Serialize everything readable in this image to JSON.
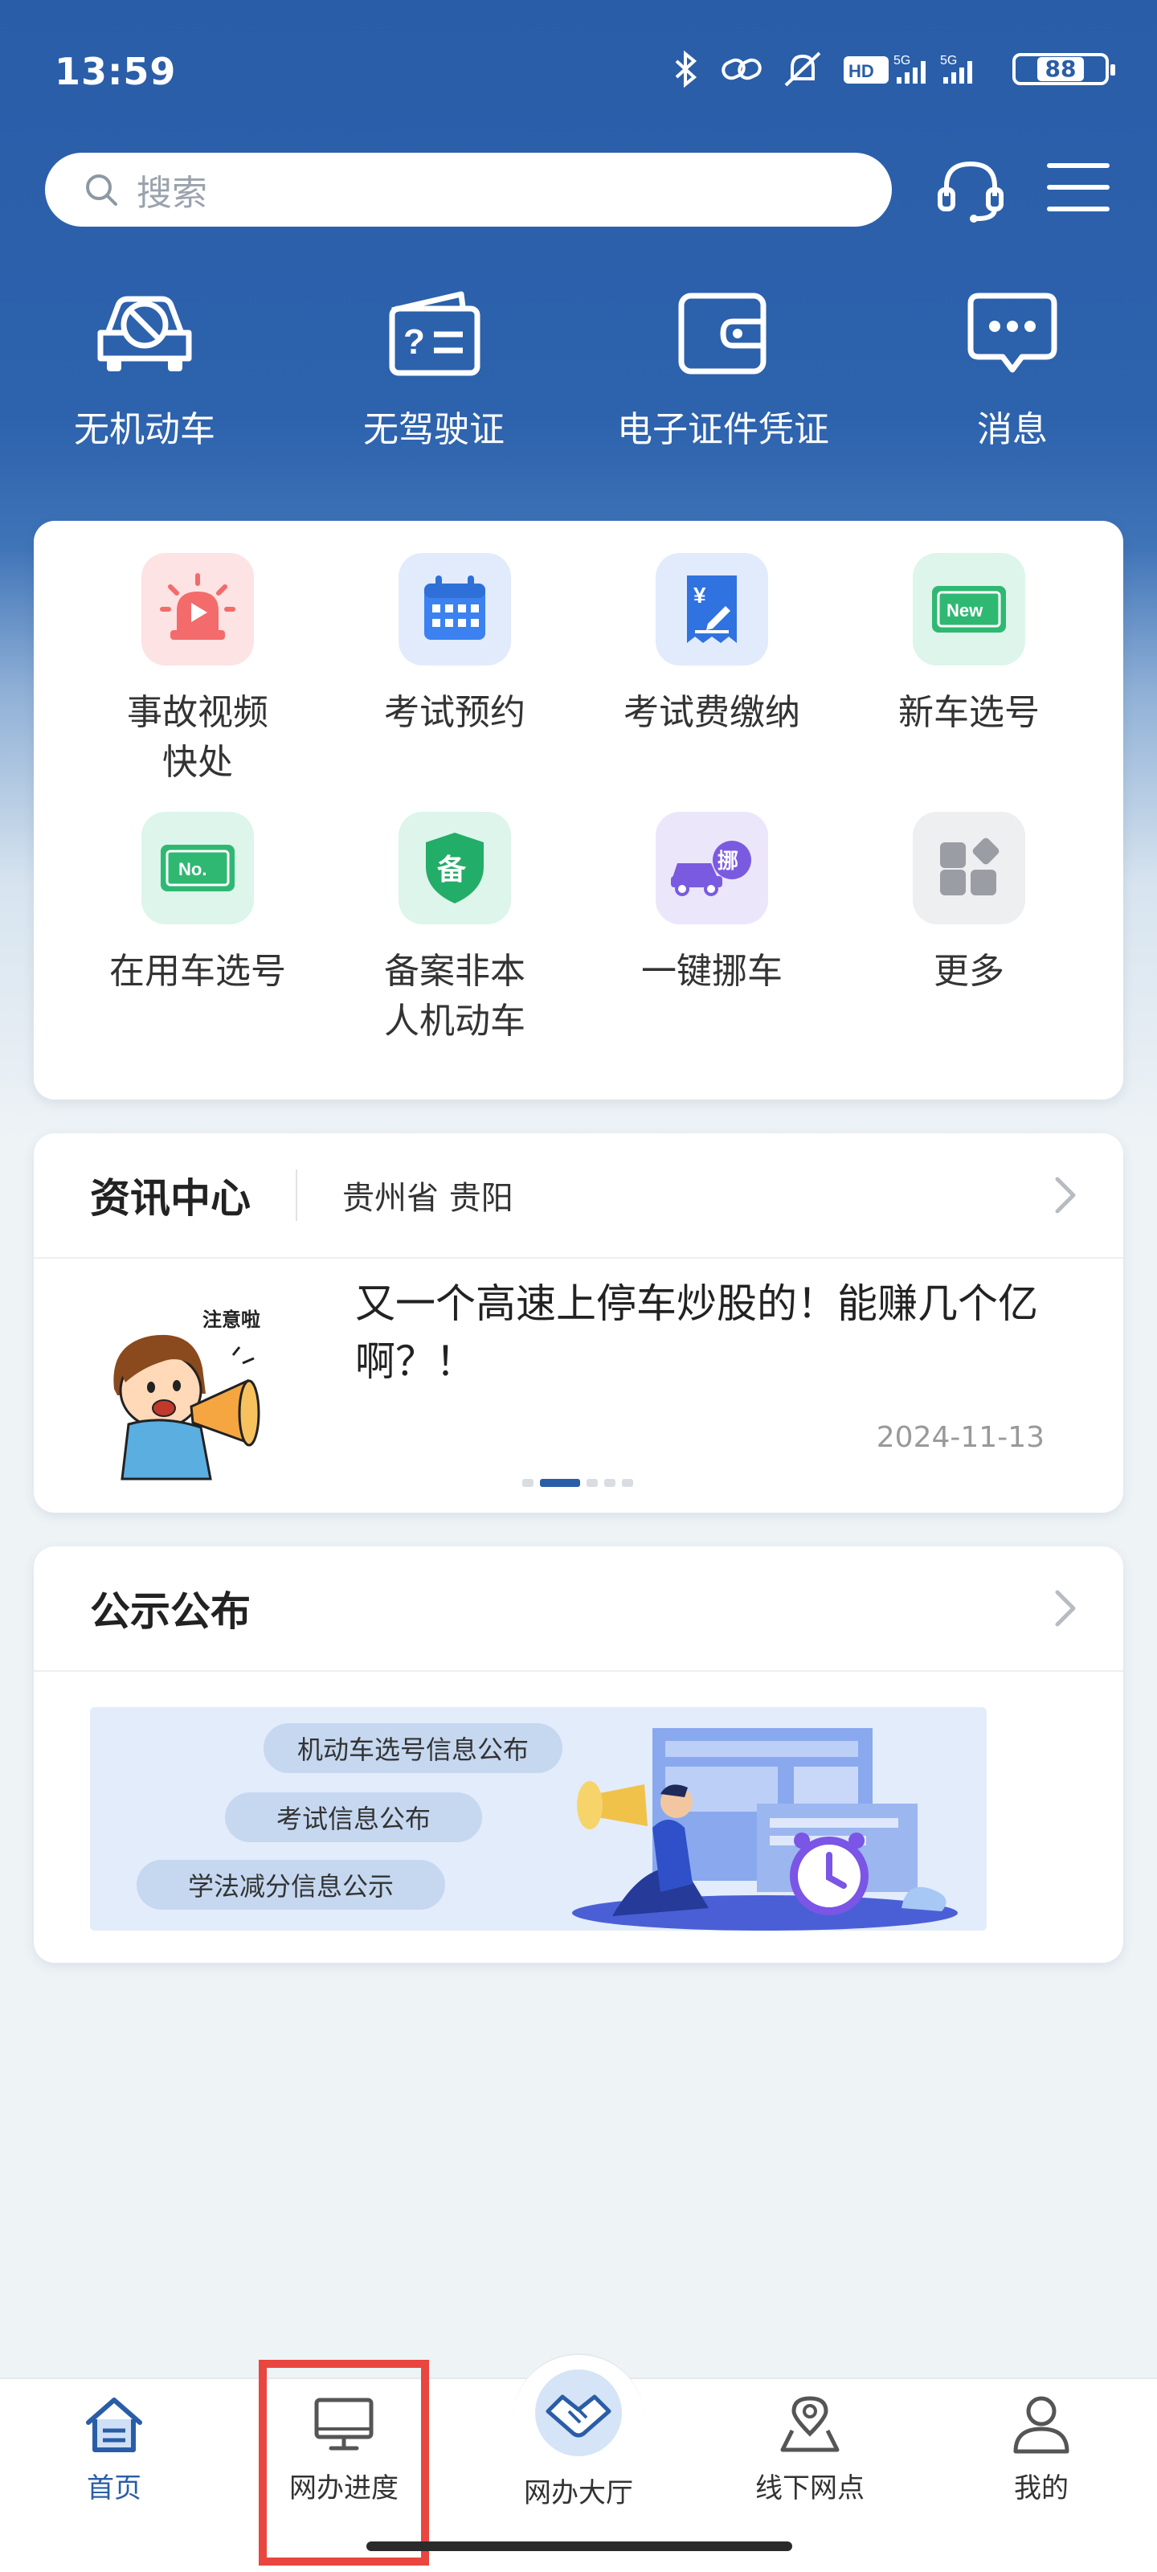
{
  "status_bar": {
    "time": "13:59",
    "battery": "88"
  },
  "search": {
    "placeholder": "搜索"
  },
  "quick_actions": [
    {
      "label": "无机动车",
      "icon": "no-car-icon"
    },
    {
      "label": "无驾驶证",
      "icon": "no-license-icon"
    },
    {
      "label": "电子证件凭证",
      "icon": "wallet-icon"
    },
    {
      "label": "消息",
      "icon": "message-icon"
    }
  ],
  "services": [
    {
      "label": "事故视频\n快处",
      "icon": "alarm-light-icon"
    },
    {
      "label": "考试预约",
      "icon": "calendar-icon"
    },
    {
      "label": "考试费缴纳",
      "icon": "receipt-icon"
    },
    {
      "label": "新车选号",
      "icon": "new-plate-icon"
    },
    {
      "label": "在用车选号",
      "icon": "plate-no-icon"
    },
    {
      "label": "备案非本\n人机动车",
      "icon": "shield-icon"
    },
    {
      "label": "一键挪车",
      "icon": "move-car-icon"
    },
    {
      "label": "更多",
      "icon": "more-grid-icon"
    }
  ],
  "news": {
    "title": "资讯中心",
    "region": "贵州省 贵阳",
    "headline": "又一个高速上停车炒股的！能赚几个亿啊？！",
    "date": "2024-11-13",
    "image_caption": "注意啦"
  },
  "notice": {
    "title": "公示公布",
    "pills": [
      "机动车选号信息公布",
      "考试信息公布",
      "学法减分信息公示"
    ]
  },
  "tabs": [
    {
      "label": "首页",
      "icon": "home-icon",
      "active": true
    },
    {
      "label": "网办进度",
      "icon": "monitor-icon",
      "active": false
    },
    {
      "label": "网办大厅",
      "icon": "handshake-icon",
      "active": false
    },
    {
      "label": "线下网点",
      "icon": "map-pin-icon",
      "active": false
    },
    {
      "label": "我的",
      "icon": "user-icon",
      "active": false
    }
  ],
  "colors": {
    "primary": "#2a5da8",
    "highlight": "#e8463f"
  }
}
